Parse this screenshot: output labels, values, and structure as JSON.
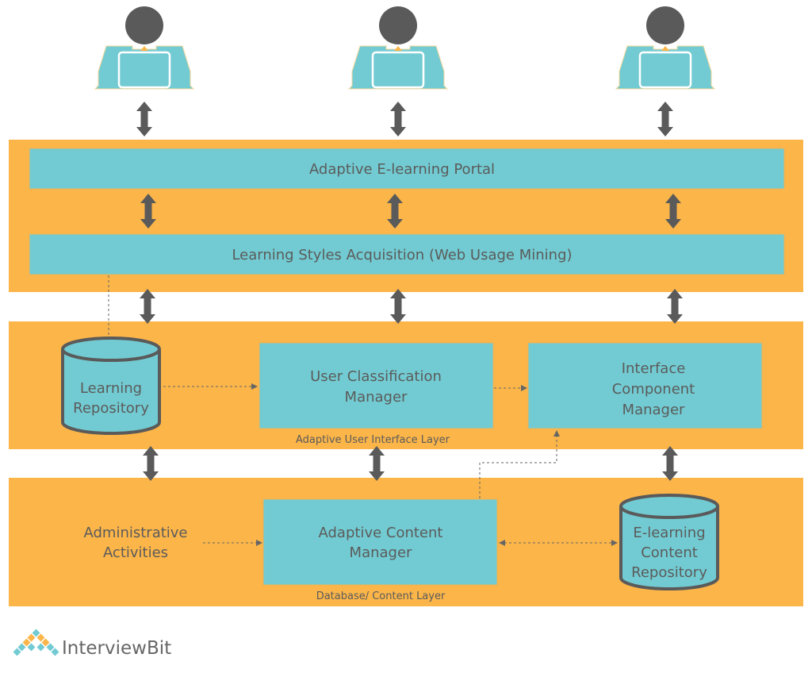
{
  "colors": {
    "band": "#fbb549",
    "box": "#72cbd2",
    "arrow": "#5a5a5a",
    "text": "#5b5b5b",
    "head": "#5a5a5a"
  },
  "users": [
    {
      "icon": "user-at-laptop-icon"
    },
    {
      "icon": "user-at-laptop-icon"
    },
    {
      "icon": "user-at-laptop-icon"
    }
  ],
  "portal": "Adaptive E-learning Portal",
  "lsa": "Learning Styles Acquisition (Web Usage Mining)",
  "learning_repo": [
    "Learning",
    "Repository"
  ],
  "ucm": [
    "User Classification",
    "Manager"
  ],
  "icm": [
    "Interface",
    "Component",
    "Manager"
  ],
  "ui_layer": "Adaptive User Interface Layer",
  "admin": [
    "Administrative",
    "Activities"
  ],
  "acm": [
    "Adaptive Content",
    "Manager"
  ],
  "content_repo": [
    "E-learning",
    "Content",
    "Repository"
  ],
  "db_layer": "Database/ Content Layer",
  "logo": "InterviewBit"
}
